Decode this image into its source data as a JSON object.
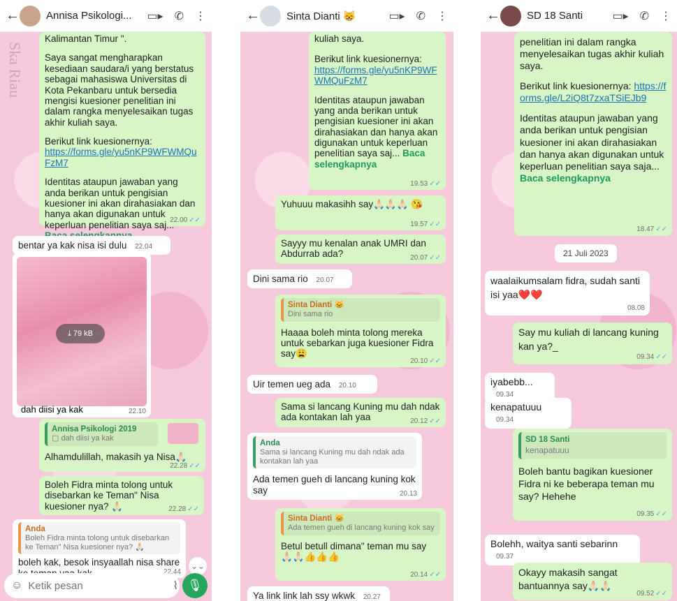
{
  "panels": [
    {
      "header": {
        "name": "Annisa Psikologi..."
      },
      "messages": {
        "m1": {
          "p1": "Kalimantan Timur \".",
          "p2": "Saya sangat mengharapkan kesediaan saudara/i yang berstatus sebagai mahasiswa Universitas di Kota Pekanbaru untuk bersedia mengisi kuesioner penelitian ini dalam rangka menyelesaikan tugas akhir kuliah saya.",
          "p3": "Berikut link kuesionernya:",
          "link": "https://forms.gle/yu5nKP9WFWMQuFzM7",
          "p4": "Identitas ataupun jawaban yang anda berikan untuk pengisian kuesioner ini akan dirahasiakan dan hanya akan digunakan untuk keperluan penelitian saya saj...",
          "more": "Baca selengkapnya",
          "time": "22.00"
        },
        "m2": {
          "text": "bentar ya kak nisa isi dulu",
          "time": "22.04"
        },
        "m3": {
          "size": "⤓ 79 kB",
          "caption": "dah diisi ya kak",
          "time": "22.10"
        },
        "m4": {
          "quote_name": "Annisa Psikologi 2019",
          "quote_text": "▢ dah diisi ya kak",
          "text": "Alhamdulillah, makasih ya Nisa🙏🏻",
          "time": "22.28"
        },
        "m5": {
          "text": "Boleh Fidra minta tolong untuk disebarkan ke Teman\" Nisa kuesioner nya? 🙏🏻",
          "time": "22.28"
        },
        "m6": {
          "quote_name": "Anda",
          "quote_text": "Boleh Fidra minta tolong untuk disebarkan ke Teman\" Nisa kuesioner nya? 🙏🏻",
          "text": "boleh kak, besok insyaallah nisa share ke teman yaa kak",
          "time": "22.44"
        }
      },
      "input": {
        "placeholder": "Ketik pesan"
      }
    },
    {
      "header": {
        "name": "Sinta Dianti 😸"
      },
      "messages": {
        "m1": {
          "p1": "kuliah saya.",
          "p2": "Berikut link kuesionernya:",
          "link": "https://forms.gle/yu5nKP9WFWMQuFzM7",
          "p3": "Identitas ataupun jawaban yang anda berikan untuk pengisian kuesioner ini akan dirahasiakan dan hanya akan digunakan untuk keperluan penelitian saya saj...",
          "more": "Baca selengkapnya",
          "time": "19.53"
        },
        "m2": {
          "text": "Yuhuuu makasihh say🙏🏻🙏🏻🙏🏻 😘",
          "time": "19.57"
        },
        "m3": {
          "text": "Sayyy mu kenalan anak UMRI dan Abdurrab ada?",
          "time": "20.07"
        },
        "m4": {
          "text": "Dini sama rio",
          "time": "20.07"
        },
        "m5": {
          "quote_name": "Sinta Dianti 😸",
          "quote_text": "Dini sama rio",
          "text": "Haaaa boleh minta tolong mereka untuk sebarkan juga kuesioner Fidra say😩",
          "time": "20.10"
        },
        "m6": {
          "text": "Uir temen ueg ada",
          "time": "20.10"
        },
        "m7": {
          "text": "Sama si lancang Kuning mu dah ndak ada kontakan lah yaa",
          "time": "20.12"
        },
        "m8": {
          "quote_name": "Anda",
          "quote_text": "Sama si lancang Kuning mu dah ndak ada kontakan lah yaa",
          "text": "Ada temen gueh di lancang kuning kok say",
          "time": "20.13"
        },
        "m9": {
          "quote_name": "Sinta Dianti 😸",
          "quote_text": "Ada temen gueh di lancang kuning kok say",
          "text": "Betul betull dimana\" teman mu say 🙏🏻🙏🏻👍👍👍",
          "time": "20.14"
        },
        "m10": {
          "text": "Ya link link lah ssy wkwk",
          "time": "20.27"
        }
      }
    },
    {
      "header": {
        "name": "SD 18 Santi"
      },
      "messages": {
        "m1": {
          "p1": "penelitian ini dalam rangka menyelesaikan tugas akhir kuliah saya.",
          "p2": "Berikut link kuesionernya: ",
          "link": "https://forms.gle/L2iQ8t7zxaTSiEJb9",
          "p3": "Identitas ataupun jawaban yang anda berikan untuk pengisian kuesioner ini akan dirahasiakan dan hanya akan digunakan untuk keperluan penelitian saya saja...",
          "more": "Baca selengkapnya",
          "time": "18.47"
        },
        "date": "21 Juli 2023",
        "m2": {
          "text": "waalaikumsalam fidra, sudah santi isi yaa❤️❤️",
          "time": "08.08"
        },
        "m3": {
          "text": "Say mu kuliah di lancang kuning kan ya?_",
          "time": "09.34"
        },
        "m4": {
          "text": "iyabebb...",
          "time": "09.34"
        },
        "m5": {
          "text": "kenapatuuu",
          "time": "09.34"
        },
        "m6": {
          "quote_name": "SD 18 Santi",
          "quote_text": "kenapatuuu",
          "text": "Boleh bantu bagikan kuesioner Fidra ni ke beberapa teman mu say? Hehehe",
          "time": "09.35"
        },
        "m7": {
          "text": "Bolehh, waitya santi sebarinn",
          "time": "09.37"
        },
        "m8": {
          "text": "Okayy makasih sangat bantuannya say🙏🏻🙏🏻",
          "time": "09.52"
        }
      }
    }
  ],
  "icons": {
    "back": "arrow-left-icon",
    "video": "video-camera-icon",
    "call": "phone-icon",
    "menu": "kebab-menu-icon",
    "emoji": "emoji-icon",
    "attach": "paperclip-icon",
    "camera": "camera-icon",
    "mic": "microphone-icon",
    "tick": "double-check-icon",
    "download": "download-icon"
  },
  "colors": {
    "outgoing": "#d8f5c5",
    "incoming": "#ffffff",
    "link": "#1a73b8",
    "accent": "#25a65a",
    "wallpaper": "#f6c9dc"
  }
}
